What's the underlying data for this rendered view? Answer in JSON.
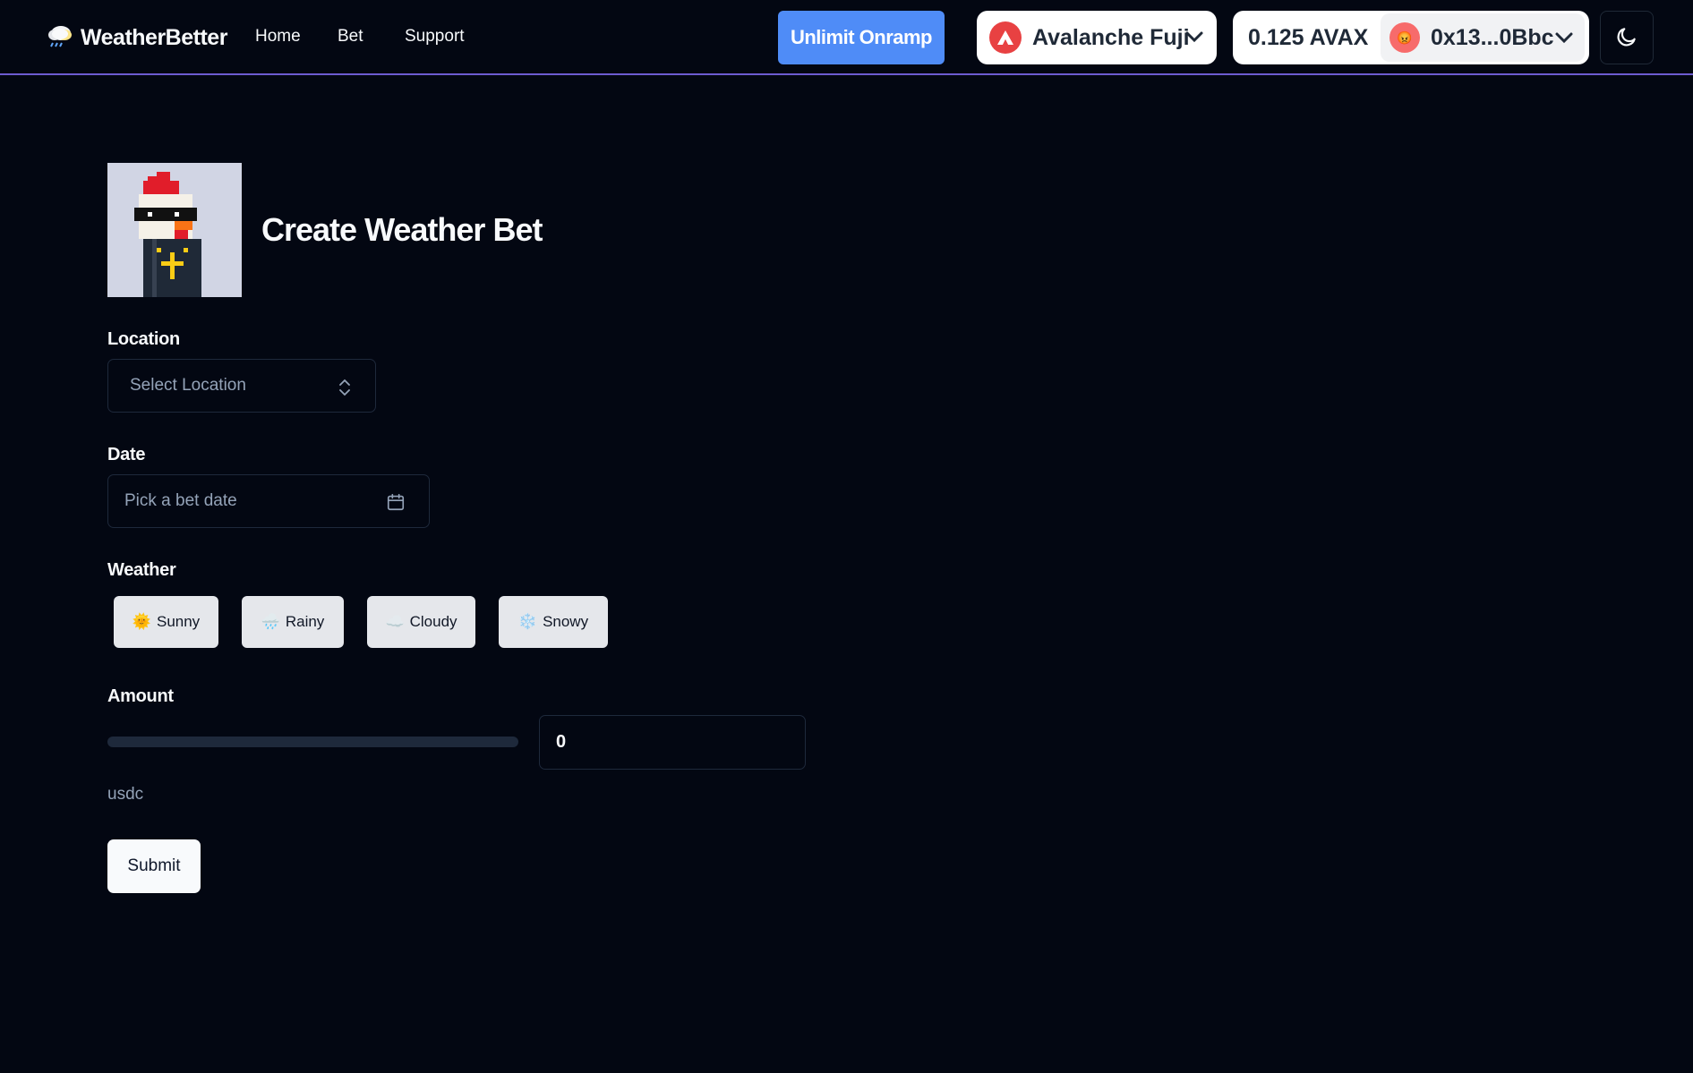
{
  "brand": {
    "name": "WeatherBetter",
    "icon": "cloud-rain-icon"
  },
  "nav": {
    "links": [
      "Home",
      "Bet",
      "Support"
    ]
  },
  "onramp_label": "Unlimit Onramp",
  "chain": {
    "name": "Avalanche Fuji",
    "icon": "avalanche-logo-icon",
    "color": "#e84142"
  },
  "account": {
    "balance": "0.125 AVAX",
    "address": "0x13...0Bbc"
  },
  "theme_toggle_icon": "moon-icon",
  "page": {
    "title": "Create Weather Bet"
  },
  "form": {
    "location": {
      "label": "Location",
      "placeholder": "Select Location"
    },
    "date": {
      "label": "Date",
      "placeholder": "Pick a bet date"
    },
    "weather": {
      "label": "Weather",
      "options": [
        {
          "emoji": "🌞",
          "label": "Sunny"
        },
        {
          "emoji": "🌧️",
          "label": "Rainy"
        },
        {
          "emoji": "☁️",
          "label": "Cloudy"
        },
        {
          "emoji": "❄️",
          "label": "Snowy"
        }
      ]
    },
    "amount": {
      "label": "Amount",
      "value": "0",
      "slider_fraction": 0,
      "unit": "usdc"
    },
    "submit_label": "Submit"
  },
  "colors": {
    "accent": "#4f8cf7",
    "background": "#030712",
    "nav_border": "#6d5bd0"
  }
}
